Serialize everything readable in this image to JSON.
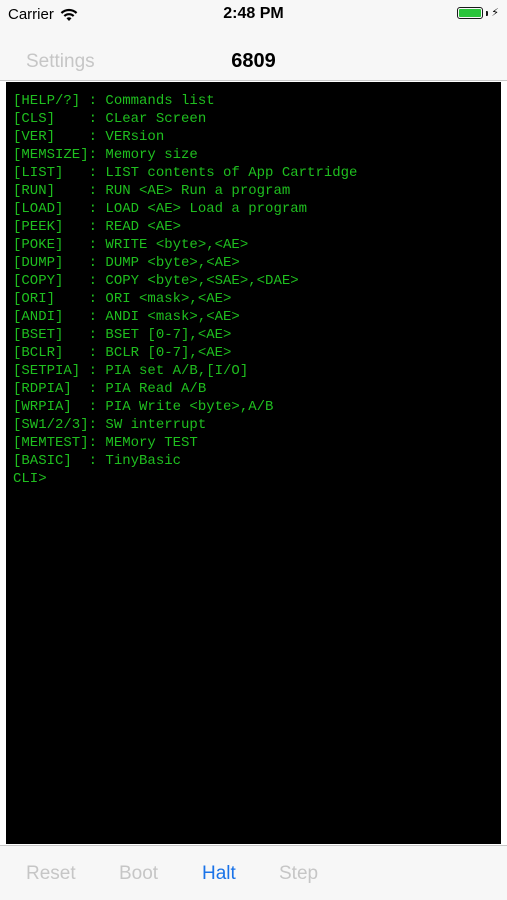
{
  "status_bar": {
    "carrier": "Carrier",
    "time": "2:48 PM",
    "battery_level": 1.0,
    "charging": true,
    "icons": [
      "wifi-icon",
      "battery-icon",
      "bolt-icon"
    ]
  },
  "nav": {
    "back_label": "Settings",
    "title": "6809"
  },
  "terminal": {
    "text_color": "#1fbf1f",
    "background": "#000000",
    "lines": [
      "[HELP/?] : Commands list",
      "[CLS]    : CLear Screen",
      "[VER]    : VERsion",
      "[MEMSIZE]: Memory size",
      "[LIST]   : LIST contents of App Cartridge",
      "[RUN]    : RUN <AE> Run a program",
      "[LOAD]   : LOAD <AE> Load a program",
      "[PEEK]   : READ <AE>",
      "[POKE]   : WRITE <byte>,<AE>",
      "[DUMP]   : DUMP <byte>,<AE>",
      "[COPY]   : COPY <byte>,<SAE>,<DAE>",
      "[ORI]    : ORI <mask>,<AE>",
      "[ANDI]   : ANDI <mask>,<AE>",
      "[BSET]   : BSET [0-7],<AE>",
      "[BCLR]   : BCLR [0-7],<AE>",
      "[SETPIA] : PIA set A/B,[I/O]",
      "[RDPIA]  : PIA Read A/B",
      "[WRPIA]  : PIA Write <byte>,A/B",
      "[SW1/2/3]: SW interrupt",
      "[MEMTEST]: MEMory TEST",
      "[BASIC]  : TinyBasic",
      "CLI>"
    ]
  },
  "toolbar": {
    "reset_label": "Reset",
    "boot_label": "Boot",
    "halt_label": "Halt",
    "step_label": "Step",
    "active_button": "Halt",
    "accent_color": "#1a73e8",
    "disabled_color": "#c6c6c6"
  }
}
